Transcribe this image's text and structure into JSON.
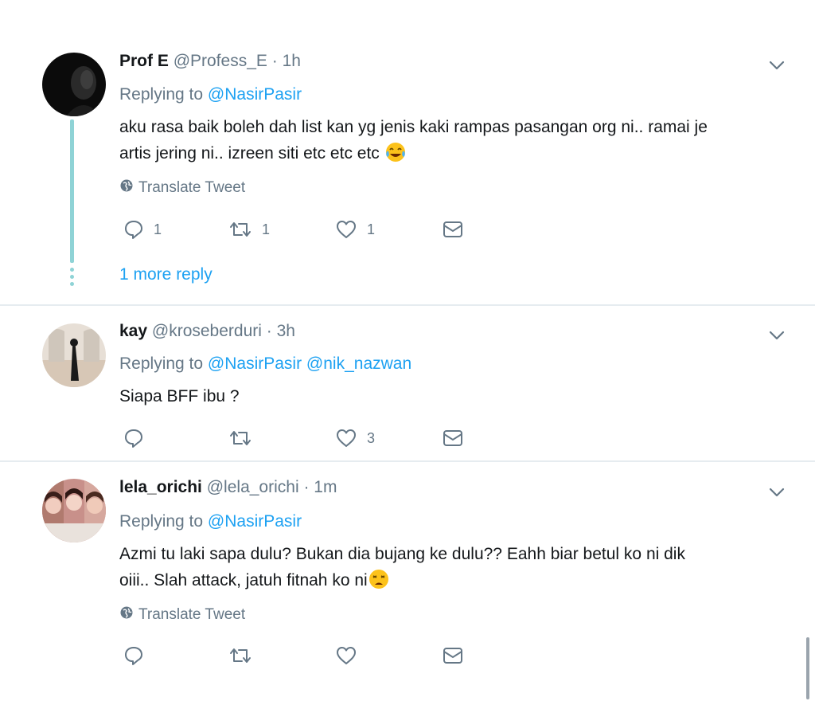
{
  "tweets": [
    {
      "name": "Prof E",
      "handle": "@Profess_E",
      "separator": "·",
      "time": "1h",
      "replying_label": "Replying to",
      "mentions": [
        "@NasirPasir"
      ],
      "text_line1": "aku rasa baik boleh dah list kan yg jenis kaki rampas pasangan org ni.. ramai je",
      "text_line2": "artis jering ni.. izreen siti  etc etc etc",
      "emoji": "face-with-tears-of-joy",
      "translate_label": "Translate Tweet",
      "actions": {
        "replies": "1",
        "retweets": "1",
        "likes": "1"
      },
      "more_replies": "1 more reply"
    },
    {
      "name": "kay",
      "handle": "@kroseberduri",
      "separator": "·",
      "time": "3h",
      "replying_label": "Replying to",
      "mentions": [
        "@NasirPasir",
        "@nik_nazwan"
      ],
      "text_line1": "Siapa BFF ibu ?",
      "actions": {
        "replies": "",
        "retweets": "",
        "likes": "3"
      }
    },
    {
      "name": "lela_orichi",
      "handle": "@lela_orichi",
      "separator": "·",
      "time": "1m",
      "replying_label": "Replying to",
      "mentions": [
        "@NasirPasir"
      ],
      "text_line1": "Azmi tu laki sapa dulu? Bukan dia bujang ke dulu?? Eahh biar betul ko ni dik",
      "text_line2": "oiii.. Slah attack, jatuh fitnah ko ni",
      "emoji": "weary-face",
      "translate_label": "Translate Tweet",
      "actions": {
        "replies": "",
        "retweets": "",
        "likes": ""
      }
    }
  ],
  "icons": {
    "reply": "reply-icon",
    "retweet": "retweet-icon",
    "like": "heart-icon",
    "dm": "envelope-icon",
    "globe": "globe-icon",
    "caret": "chevron-down-icon"
  },
  "colors": {
    "link": "#1da1f2",
    "muted": "#657786",
    "thread": "#8fd3d6",
    "divider": "#e6ecf0"
  }
}
